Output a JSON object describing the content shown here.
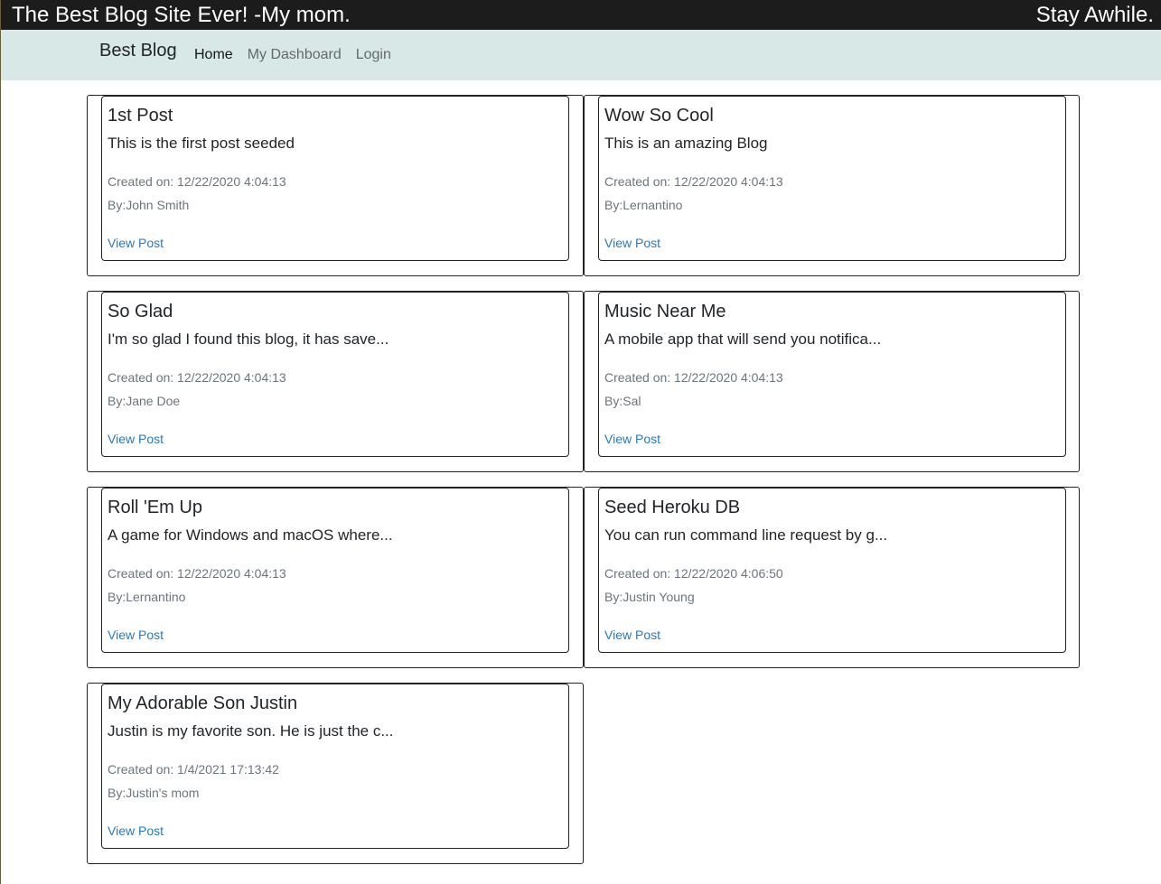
{
  "header": {
    "left_text": "The Best Blog Site Ever! -My mom.",
    "right_text": "Stay Awhile."
  },
  "navbar": {
    "brand": "Best Blog",
    "links": [
      {
        "label": "Home",
        "active": true
      },
      {
        "label": "My Dashboard",
        "active": false
      },
      {
        "label": "Login",
        "active": false
      }
    ]
  },
  "posts": [
    {
      "title": "1st Post",
      "excerpt": "This is the first post seeded",
      "created": "Created on: 12/22/2020 4:04:13",
      "author": "By:John Smith",
      "link": "View Post"
    },
    {
      "title": "Wow So Cool",
      "excerpt": "This is an amazing Blog",
      "created": "Created on: 12/22/2020 4:04:13",
      "author": "By:Lernantino",
      "link": "View Post"
    },
    {
      "title": "So Glad",
      "excerpt": "I'm so glad I found this blog, it has save...",
      "created": "Created on: 12/22/2020 4:04:13",
      "author": "By:Jane Doe",
      "link": "View Post"
    },
    {
      "title": "Music Near Me",
      "excerpt": "A mobile app that will send you notifica...",
      "created": "Created on: 12/22/2020 4:04:13",
      "author": "By:Sal",
      "link": "View Post"
    },
    {
      "title": "Roll 'Em Up",
      "excerpt": "A game for Windows and macOS where...",
      "created": "Created on: 12/22/2020 4:04:13",
      "author": "By:Lernantino",
      "link": "View Post"
    },
    {
      "title": "Seed Heroku DB",
      "excerpt": "You can run command line request by g...",
      "created": "Created on: 12/22/2020 4:06:50",
      "author": "By:Justin Young",
      "link": "View Post"
    },
    {
      "title": "My Adorable Son Justin",
      "excerpt": "Justin is my favorite son. He is just the c...",
      "created": "Created on: 1/4/2021 17:13:42",
      "author": "By:Justin's mom",
      "link": "View Post"
    }
  ]
}
